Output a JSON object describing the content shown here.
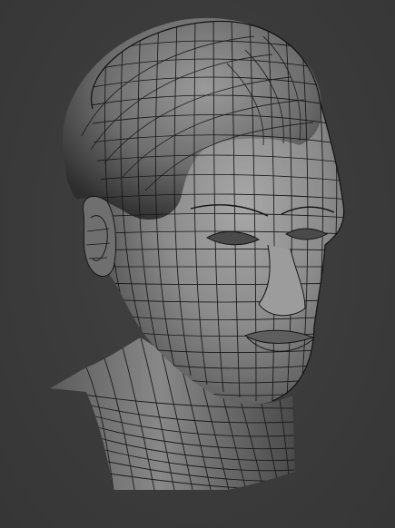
{
  "scene": {
    "subject": "head-bust-wireframe",
    "background_color": "#3a3a3a",
    "mesh_color": "#8c8c8c",
    "wire_color": "#161616"
  }
}
